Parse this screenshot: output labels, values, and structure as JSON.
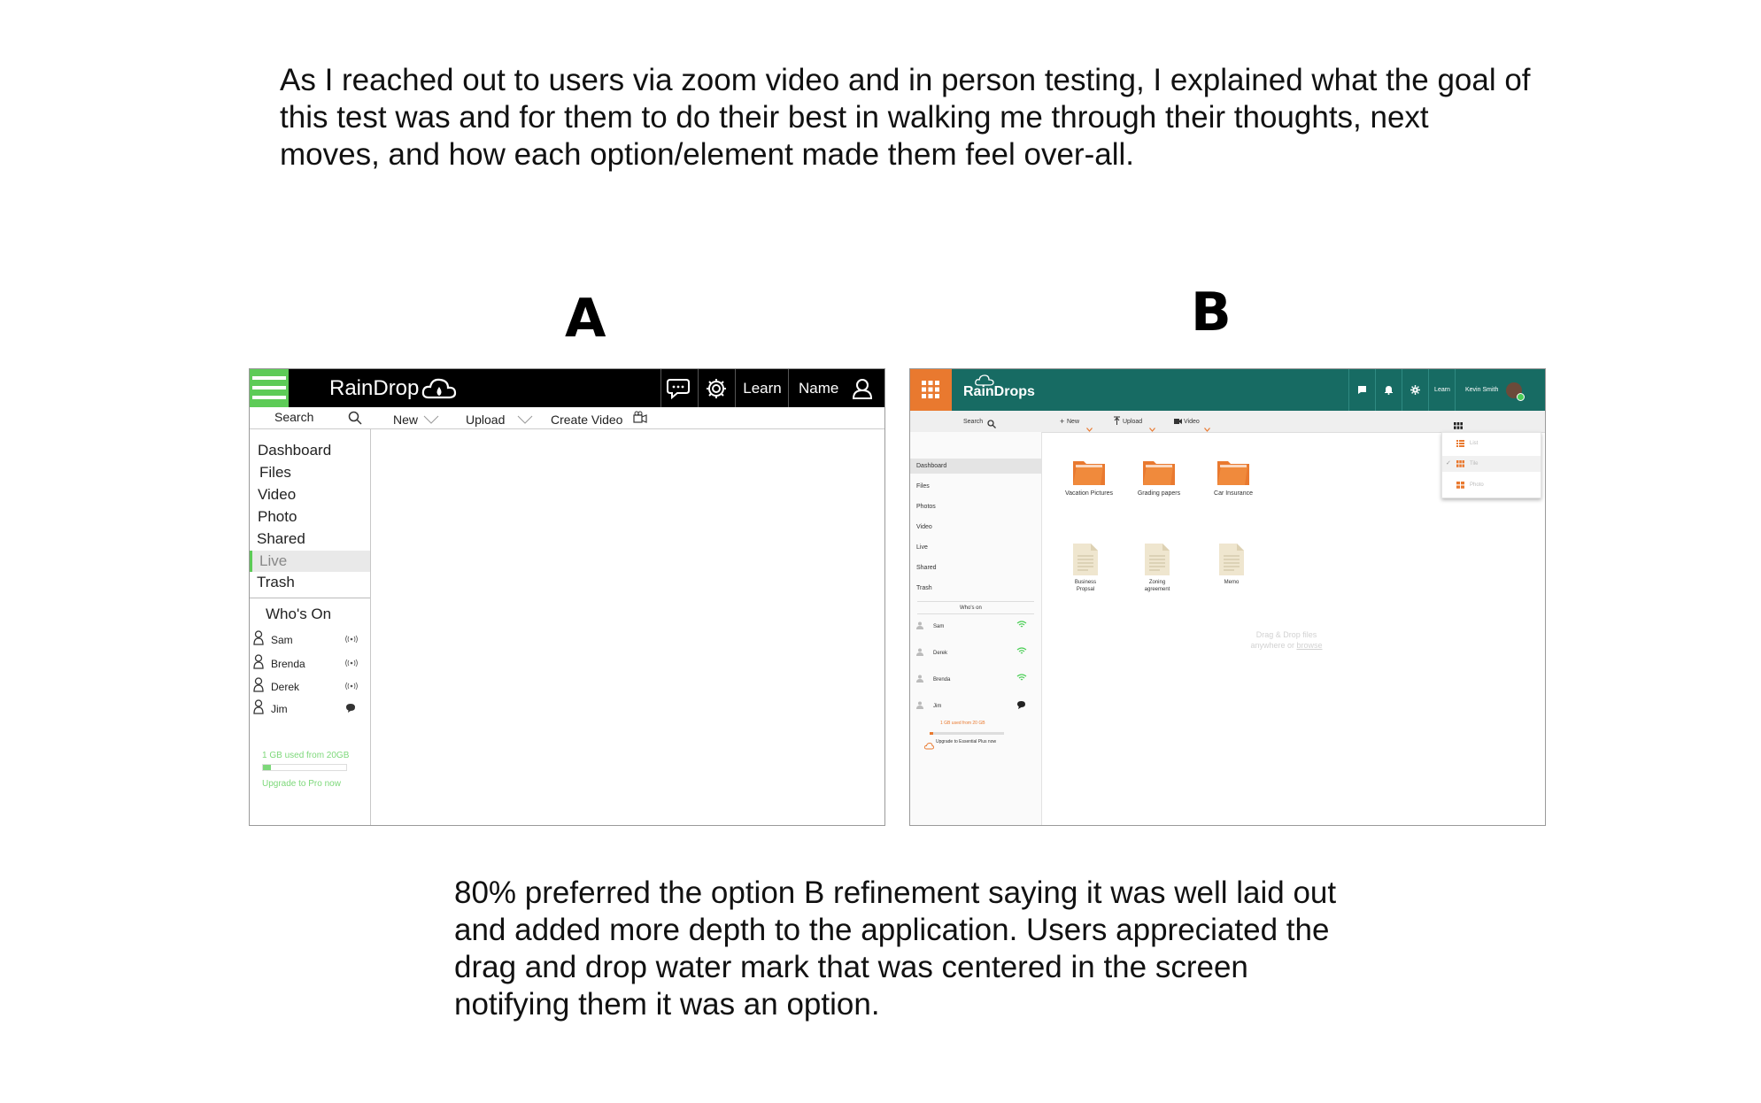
{
  "intro_text": "As I reached out to users via zoom video and in person testing, I explained what the goal of this test was and for them to do their best in walking  me through their thoughts, next moves, and how each option/element  made them feel over-all.",
  "outro_text": "80% preferred the option B refinement saying it was well laid out and added more depth to the application. Users appreciated the drag and drop water mark that was centered in the screen notifying them it was an option.",
  "labels": {
    "a": "A",
    "b": "B"
  },
  "colors": {
    "green_accent": "#5dcb57",
    "teal_header": "#176b63",
    "orange_accent": "#e9792f"
  },
  "mock_a": {
    "brand": "RainDrop",
    "learn": "Learn",
    "name": "Name",
    "search": "Search",
    "actions": {
      "new": "New",
      "upload": "Upload",
      "create_video": "Create Video"
    },
    "nav": [
      "Dashboard",
      "Files",
      "Video",
      "Photo",
      "Shared",
      "Live",
      "Trash"
    ],
    "active_nav": "Live",
    "whos_on": "Who's On",
    "users": [
      {
        "name": "Sam",
        "status": "live"
      },
      {
        "name": "Brenda",
        "status": "live"
      },
      {
        "name": "Derek",
        "status": "live"
      },
      {
        "name": "Jim",
        "status": "chat"
      }
    ],
    "storage": "1 GB used from 20GB",
    "storage_fraction": 0.1,
    "upgrade": "Upgrade to Pro now"
  },
  "mock_b": {
    "brand": "RainDrops",
    "learn": "Learn",
    "user_name": "Kevin Smith",
    "search": "Search",
    "actions": {
      "new": "New",
      "upload": "Upload",
      "video": "Video"
    },
    "nav": [
      "Dashboard",
      "Files",
      "Photos",
      "Video",
      "Live",
      "Shared",
      "Trash"
    ],
    "active_nav": "Dashboard",
    "whos_on": "Who's on",
    "users": [
      {
        "name": "Sam",
        "status": "online"
      },
      {
        "name": "Derek",
        "status": "online"
      },
      {
        "name": "Brenda",
        "status": "online"
      },
      {
        "name": "Jim",
        "status": "chat"
      }
    ],
    "storage": "1 GB used from 20 GB",
    "storage_fraction": 0.05,
    "upgrade": "Upgrade to Essential Plus now",
    "folders": [
      "Vacation Pictures",
      "Grading papers",
      "Car Insurance"
    ],
    "docs": [
      {
        "line1": "Business",
        "line2": "Propsal"
      },
      {
        "line1": "Zoning",
        "line2": "agreement"
      },
      {
        "line1": "Memo",
        "line2": ""
      }
    ],
    "drop_line1": "Drag & Drop files",
    "drop_line2_pre": "anywhere or ",
    "drop_link": "browse",
    "view_menu": {
      "items": [
        "List",
        "Tile",
        "Photo"
      ],
      "selected": "Tile"
    }
  }
}
